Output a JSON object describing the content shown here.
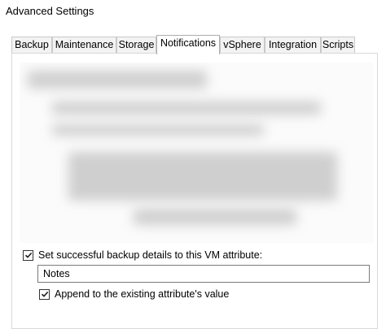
{
  "window": {
    "title": "Advanced Settings"
  },
  "tabs": [
    {
      "label": "Backup",
      "active": false
    },
    {
      "label": "Maintenance",
      "active": false
    },
    {
      "label": "Storage",
      "active": false
    },
    {
      "label": "Notifications",
      "active": true
    },
    {
      "label": "vSphere",
      "active": false
    },
    {
      "label": "Integration",
      "active": false
    },
    {
      "label": "Scripts",
      "active": false
    }
  ],
  "vm_attribute": {
    "checkbox_label": "Set successful backup details to this VM attribute:",
    "checked": true,
    "attribute_value": "Notes",
    "append_label": "Append to the existing attribute's value",
    "append_checked": true
  },
  "colors": {
    "check": "#1b1b1b",
    "panel_border": "#d9d9d9"
  }
}
